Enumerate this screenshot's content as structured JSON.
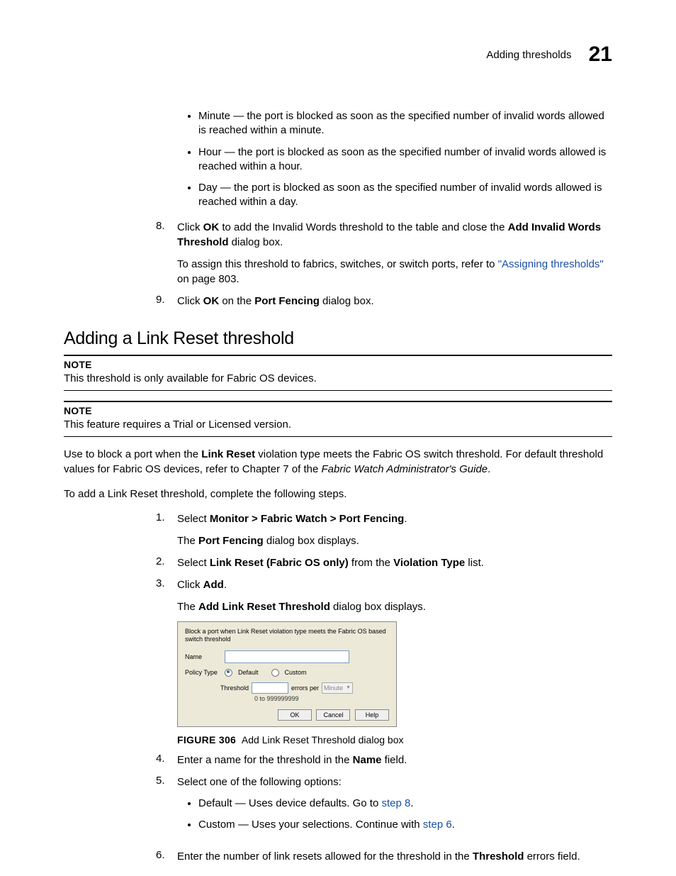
{
  "header": {
    "title": "Adding thresholds",
    "chapter": "21"
  },
  "bulletsA": [
    {
      "term": "Minute",
      "desc": " — the port is blocked as soon as the specified number of invalid words allowed is reached within a minute."
    },
    {
      "term": "Hour",
      "desc": " — the port is blocked as soon as the specified number of invalid words allowed is reached within a hour."
    },
    {
      "term": "Day",
      "desc": " — the port is blocked as soon as the specified number of invalid words allowed is reached within a day."
    }
  ],
  "steps8": {
    "num": "8.",
    "pre": "Click ",
    "ok": "OK",
    "mid": " to add the Invalid Words threshold to the table and close the ",
    "bold2": "Add Invalid Words Threshold",
    "post": " dialog box.",
    "assign_pre": "To assign this threshold to fabrics, switches, or switch ports, refer to ",
    "assign_link": "\"Assigning thresholds\"",
    "assign_post": " on page 803."
  },
  "steps9": {
    "num": "9.",
    "pre": "Click ",
    "ok": "OK",
    "mid": " on the ",
    "bold2": "Port Fencing",
    "post": " dialog box."
  },
  "section": "Adding a Link Reset threshold",
  "note1": {
    "label": "NOTE",
    "body": "This threshold is only available for Fabric OS devices."
  },
  "note2": {
    "label": "NOTE",
    "body": "This feature requires a Trial or Licensed version."
  },
  "intro": {
    "pre": "Use to block a port when the ",
    "b1": "Link Reset",
    "mid": " violation type meets the Fabric OS switch threshold. For default threshold values for Fabric OS devices, refer to Chapter 7 of the ",
    "it": "Fabric Watch Administrator's Guide",
    "post": "."
  },
  "lead": "To add a Link Reset threshold, complete the following steps.",
  "step1": {
    "num": "1.",
    "pre": "Select ",
    "path": "Monitor > Fabric Watch > Port Fencing",
    "post": ".",
    "sub_pre": "The ",
    "sub_b": "Port Fencing",
    "sub_post": " dialog box displays."
  },
  "step2": {
    "num": "2.",
    "pre": "Select ",
    "b1": "Link Reset (Fabric OS only)",
    "mid": " from the ",
    "b2": "Violation Type",
    "post": " list."
  },
  "step3": {
    "num": "3.",
    "pre": "Click ",
    "b1": "Add",
    "post": ".",
    "sub_pre": "The ",
    "sub_b": "Add Link Reset Threshold",
    "sub_post": " dialog box displays."
  },
  "dialog": {
    "desc": "Block a port when Link Reset violation type meets the Fabric OS based switch threshold",
    "name_label": "Name",
    "policy_label": "Policy Type",
    "opt_default": "Default",
    "opt_custom": "Custom",
    "thresh_label": "Threshold",
    "errors_per": "errors per",
    "dd_value": "Minute",
    "hint": "0 to 999999999",
    "btn_ok": "OK",
    "btn_cancel": "Cancel",
    "btn_help": "Help"
  },
  "figcap": {
    "label": "FIGURE 306",
    "text": "Add Link Reset Threshold dialog box"
  },
  "step4": {
    "num": "4.",
    "pre": "Enter a name for the threshold in the ",
    "b1": "Name",
    "post": " field."
  },
  "step5": {
    "num": "5.",
    "text": "Select one of the following options:",
    "opts": [
      {
        "term": "Default",
        "desc": " — Uses device defaults. Go to ",
        "link": "step 8",
        "post": "."
      },
      {
        "term": "Custom",
        "desc": " — Uses your selections. Continue with ",
        "link": "step 6",
        "post": "."
      }
    ]
  },
  "step6": {
    "num": "6.",
    "pre": "Enter the number of link resets allowed for the threshold in the ",
    "b1": "Threshold",
    "post": " errors field."
  }
}
